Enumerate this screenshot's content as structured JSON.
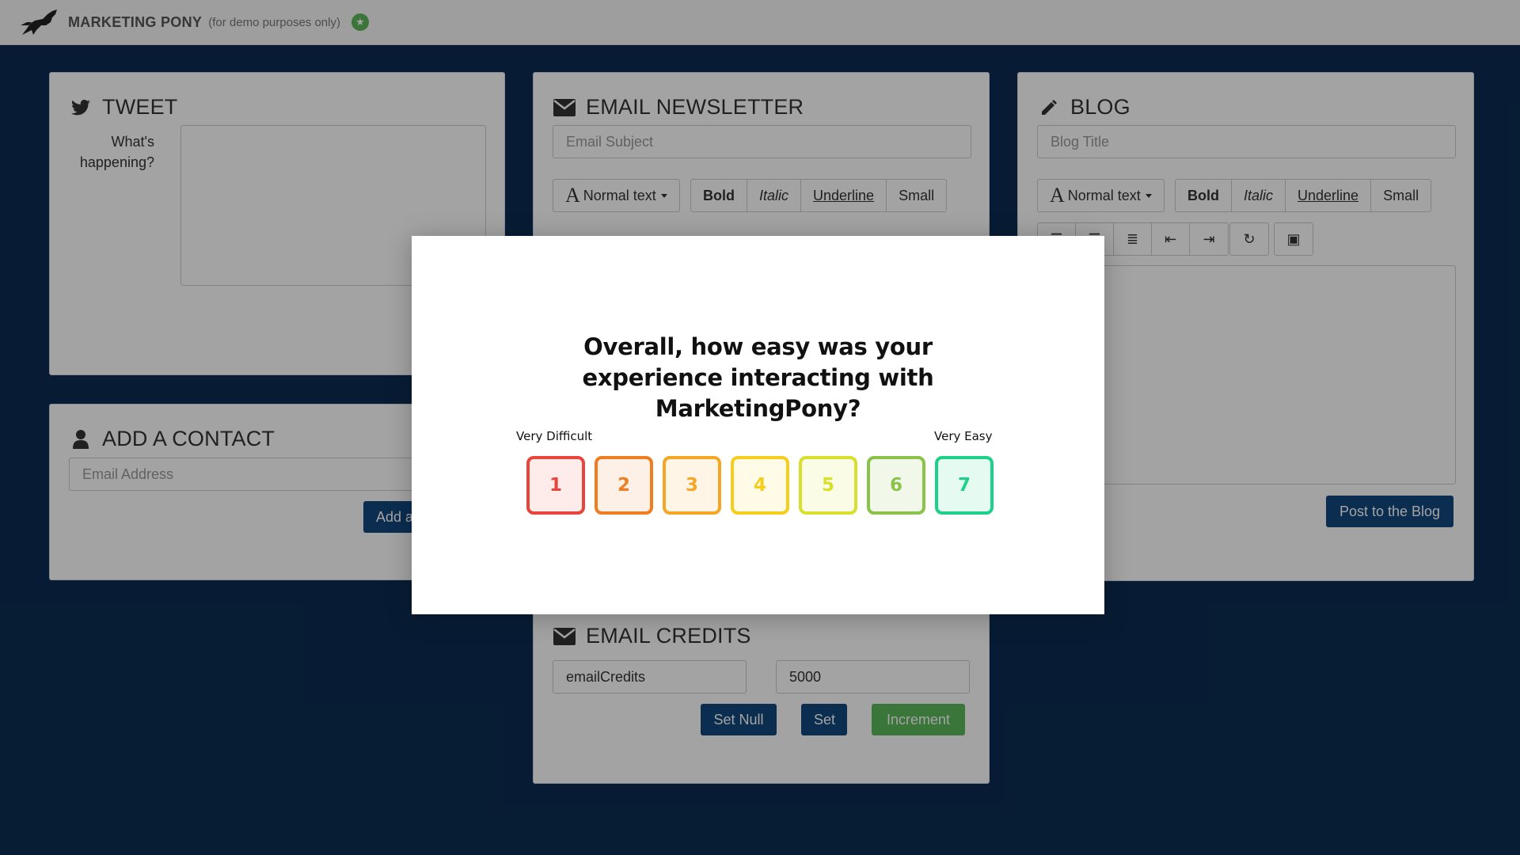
{
  "navbar": {
    "brand": "MARKETING PONY",
    "subtitle": "(for demo purposes only)"
  },
  "tweet": {
    "title": "TWEET",
    "icon": "twitter-icon",
    "label": "What's happening?"
  },
  "newsletter": {
    "title": "EMAIL NEWSLETTER",
    "icon": "envelope-icon",
    "subject_placeholder": "Email Subject",
    "text_style": "Normal text",
    "bold": "Bold",
    "italic": "Italic",
    "underline": "Underline",
    "small": "Small"
  },
  "blog": {
    "title": "BLOG",
    "icon": "pencil-icon",
    "title_placeholder": "Blog Title",
    "text_style": "Normal text",
    "bold": "Bold",
    "italic": "Italic",
    "underline": "Underline",
    "small": "Small",
    "post_button": "Post to the Blog"
  },
  "contact": {
    "title": "ADD A CONTACT",
    "icon": "user-icon",
    "email_placeholder": "Email Address",
    "add_button": "Add a"
  },
  "credits": {
    "title": "EMAIL CREDITS",
    "icon": "envelope-icon",
    "key_value": "emailCredits",
    "amount_value": "5000",
    "set_null": "Set Null",
    "set": "Set",
    "increment": "Increment"
  },
  "survey": {
    "question": "Overall, how easy was your experience interacting with MarketingPony?",
    "low_label": "Very Difficult",
    "high_label": "Very Easy",
    "ratings": [
      {
        "label": "1",
        "color": "#e8453c",
        "bg": "#fdecea"
      },
      {
        "label": "2",
        "color": "#ef7d22",
        "bg": "#fdf0e6"
      },
      {
        "label": "3",
        "color": "#f5a623",
        "bg": "#fef5e7"
      },
      {
        "label": "4",
        "color": "#f7cd1c",
        "bg": "#fffbe6"
      },
      {
        "label": "5",
        "color": "#d8e02c",
        "bg": "#fafce6"
      },
      {
        "label": "6",
        "color": "#8bc34a",
        "bg": "#f1f8e9"
      },
      {
        "label": "7",
        "color": "#1dd18b",
        "bg": "#e5faf1"
      }
    ]
  }
}
